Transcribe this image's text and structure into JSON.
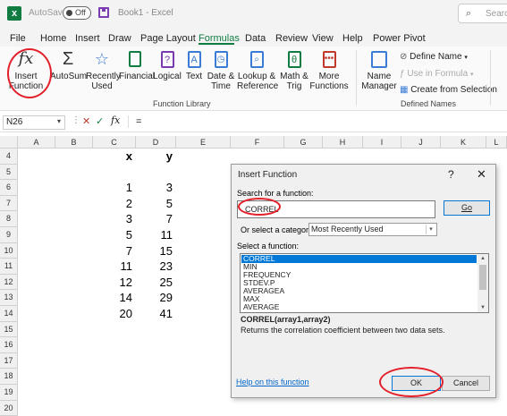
{
  "titlebar": {
    "autosave_label": "AutoSave",
    "autosave_state": "Off",
    "doc_title": "Book1 - Excel",
    "search_placeholder": "Search"
  },
  "menu": {
    "tabs": [
      "File",
      "Home",
      "Insert",
      "Draw",
      "Page Layout",
      "Formulas",
      "Data",
      "Review",
      "View",
      "Help",
      "Power Pivot"
    ],
    "active_tab": "Formulas"
  },
  "ribbon": {
    "insert_function": [
      "Insert",
      "Function"
    ],
    "autosum": "AutoSum",
    "recently_used": [
      "Recently",
      "Used"
    ],
    "financial": "Financial",
    "logical": "Logical",
    "text": "Text",
    "date_time": [
      "Date &",
      "Time"
    ],
    "lookup_reference": [
      "Lookup &",
      "Reference"
    ],
    "math_trig": [
      "Math &",
      "Trig"
    ],
    "more_functions": [
      "More",
      "Functions"
    ],
    "function_library_label": "Function Library",
    "name_manager": [
      "Name",
      "Manager"
    ],
    "define_name": "Define Name",
    "use_in_formula": "Use in Formula",
    "create_from_selection": "Create from Selection",
    "defined_names_label": "Defined Names"
  },
  "formula_bar": {
    "name_box": "N26",
    "cancel_symbol": "✕",
    "enter_symbol": "✓",
    "fx": "fx",
    "content": "="
  },
  "grid": {
    "columns": [
      "A",
      "B",
      "C",
      "D",
      "E",
      "F",
      "G",
      "H",
      "I",
      "J",
      "K",
      "L"
    ],
    "rows": [
      "4",
      "5",
      "6",
      "7",
      "8",
      "9",
      "10",
      "11",
      "12",
      "13",
      "14",
      "15",
      "16",
      "17",
      "18",
      "19",
      "20"
    ],
    "header_x": "x",
    "header_y": "y",
    "x_values": [
      "1",
      "2",
      "3",
      "5",
      "7",
      "11",
      "12",
      "14",
      "20"
    ],
    "y_values": [
      "3",
      "5",
      "7",
      "11",
      "15",
      "23",
      "25",
      "29",
      "41"
    ]
  },
  "dialog": {
    "title": "Insert Function",
    "help_symbol": "?",
    "close_symbol": "✕",
    "search_label": "Search for a function:",
    "search_value": "CORREL",
    "go_label": "Go",
    "category_label": "Or select a category:",
    "category_value": "Most Recently Used",
    "select_label": "Select a function:",
    "functions": [
      "CORREL",
      "MIN",
      "FREQUENCY",
      "STDEV.P",
      "AVERAGEA",
      "MAX",
      "AVERAGE"
    ],
    "selected_function": "CORREL",
    "signature": "CORREL(array1,array2)",
    "description": "Returns the correlation coefficient between two data sets.",
    "help_link": "Help on this function",
    "ok_label": "OK",
    "cancel_label": "Cancel"
  },
  "colors": {
    "excel_green": "#107c41",
    "annotation_red": "#e3202a",
    "selection_blue": "#0078d7"
  }
}
